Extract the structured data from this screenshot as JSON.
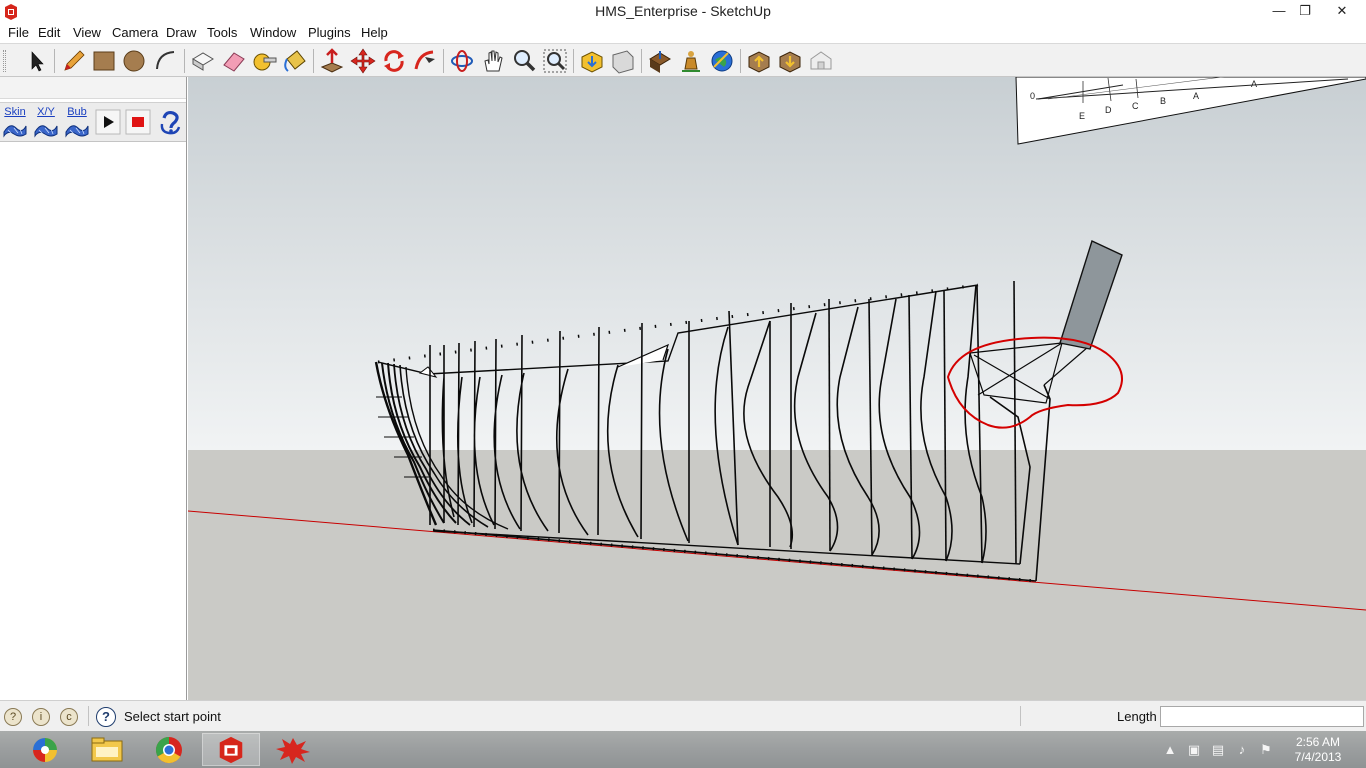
{
  "window": {
    "title": "HMS_Enterprise - SketchUp",
    "minimize_glyph": "—",
    "maximize_glyph": "❐",
    "close_glyph": "✕"
  },
  "menu": {
    "items": [
      "File",
      "Edit",
      "View",
      "Camera",
      "Draw",
      "Tools",
      "Window",
      "Plugins",
      "Help"
    ]
  },
  "toolbar": {
    "icons": [
      "select-arrow-icon",
      "pencil-line-icon",
      "rectangle-icon",
      "circle-icon",
      "arc-icon",
      "make-component-icon",
      "eraser-icon",
      "tape-measure-icon",
      "paint-bucket-icon",
      "push-pull-icon",
      "move-icon",
      "rotate-icon",
      "follow-me-icon",
      "orbit-icon",
      "pan-hand-icon",
      "zoom-icon",
      "zoom-extents-icon",
      "get-models-icon",
      "share-model-icon",
      "get-photo-texture-icon",
      "add-location-icon",
      "preview-google-earth-icon",
      "share-component-icon",
      "get-component-icon",
      "warehouse-icon"
    ]
  },
  "plugins": {
    "buttons": [
      {
        "label": "Skin",
        "icon": "skin-mesh-icon"
      },
      {
        "label": "X/Y",
        "icon": "xy-mesh-icon"
      },
      {
        "label": "Bub",
        "icon": "bubble-mesh-icon"
      }
    ],
    "play_icon": "play-icon",
    "stop_icon": "stop-icon",
    "help_icon": "help-swirl-icon"
  },
  "colors": {
    "sky_top": "#c8cfd3",
    "sky_bottom": "#f1f3f4",
    "ground": "#cacac6",
    "highlight_circle": "#d40000",
    "axis_red": "#c80000",
    "rudder_fill": "#8e969b"
  },
  "status": {
    "text": "Select start point",
    "measure_label": "Length",
    "measure_value": ""
  },
  "taskbar": {
    "apps": [
      "picasa-icon",
      "file-explorer-icon",
      "chrome-icon",
      "sketchup-icon",
      "paint-splat-icon"
    ],
    "time": "2:56 AM",
    "date": "7/4/2013"
  }
}
